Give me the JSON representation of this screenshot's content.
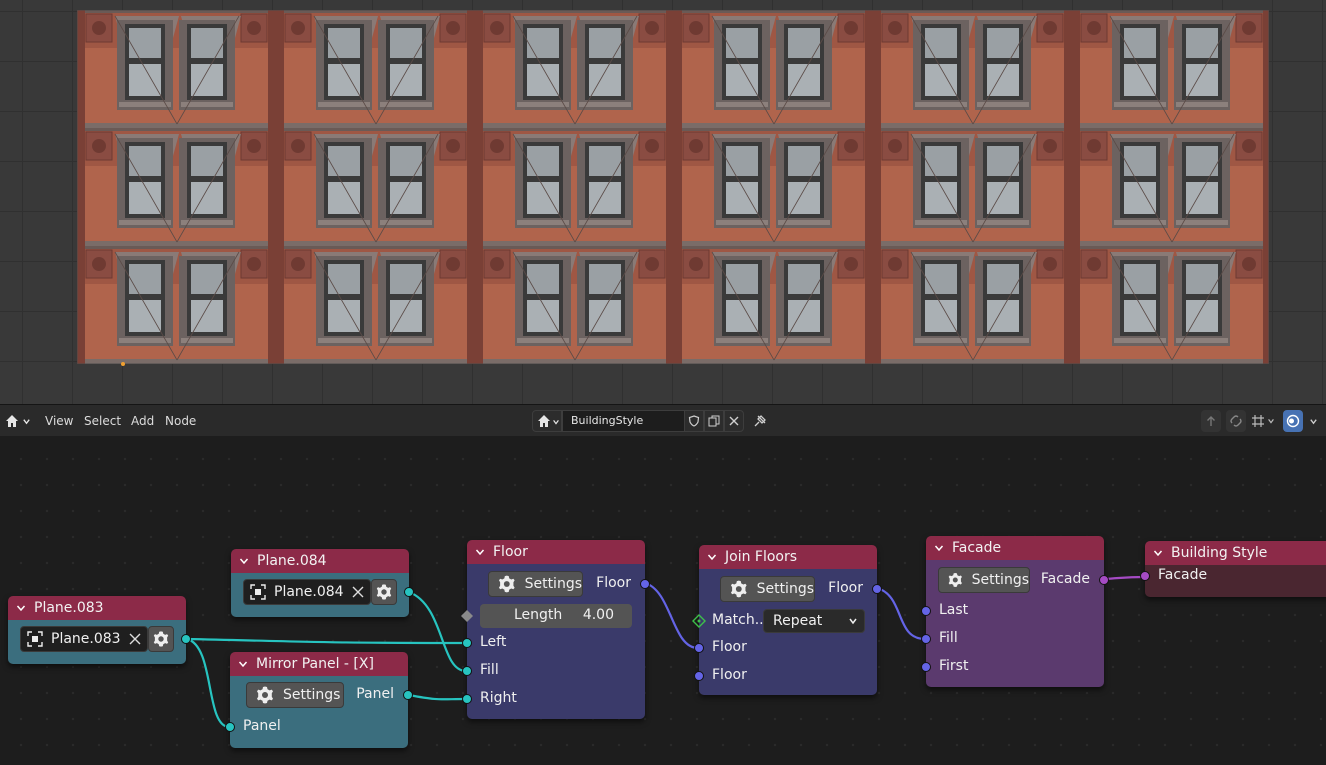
{
  "header": {
    "menus": [
      "View",
      "Select",
      "Add",
      "Node"
    ],
    "tree_name": "BuildingStyle"
  },
  "nodes": {
    "plane083": {
      "title": "Plane.083",
      "object": "Plane.083"
    },
    "plane084": {
      "title": "Plane.084",
      "object": "Plane.084"
    },
    "mirror": {
      "title": "Mirror Panel - [X]",
      "settings": "Settings",
      "out": "Panel",
      "in": "Panel"
    },
    "floor": {
      "title": "Floor",
      "settings": "Settings",
      "out": "Floor",
      "length_label": "Length",
      "length_value": "4.00",
      "in_left": "Left",
      "in_fill": "Fill",
      "in_right": "Right"
    },
    "join": {
      "title": "Join Floors",
      "settings": "Settings",
      "out": "Floor",
      "match_label": "Match...",
      "match_value": "Repeat",
      "in1": "Floor",
      "in2": "Floor"
    },
    "facade": {
      "title": "Facade",
      "settings": "Settings",
      "out": "Facade",
      "in_last": "Last",
      "in_fill": "Fill",
      "in_first": "First"
    },
    "style": {
      "title": "Building Style",
      "in": "Facade"
    }
  },
  "colors": {
    "viewport_bg": "#393939",
    "node_header": "#8c2a48",
    "object_body": "#3b6e7e",
    "floor_body": "#3a3a6a",
    "facade_body": "#5b3a6e",
    "output_body": "#4a2630",
    "socket_object": "#27c4c0",
    "socket_floor": "#6464e6",
    "socket_facade": "#a54bc4"
  }
}
